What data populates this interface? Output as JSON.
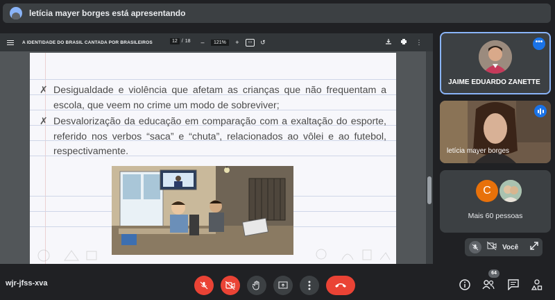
{
  "presenter_bar": {
    "text": "letícia mayer borges está apresentando"
  },
  "pdf_viewer": {
    "title": "A IDENTIDADE DO BRASIL CANTADA POR BRASILEIROS",
    "page_current": "12",
    "page_separator": "/",
    "page_total": "18",
    "zoom_minus": "–",
    "zoom": "121%",
    "zoom_plus": "+"
  },
  "slide": {
    "bullets": [
      {
        "marker": "✗",
        "text": "Desigualdade e violência que afetam as crianças que não frequentam a escola, que veem no crime um modo de sobreviver;"
      },
      {
        "marker": "✗",
        "text": "Desvalorização da educação em comparação com a exaltação do esporte, referido nos verbos “saca” e “chuta”, relacionados ao vôlei e ao futebol, respectivamente."
      }
    ]
  },
  "participants": {
    "main": {
      "name": "JAIME EDUARDO ZANETTE",
      "menu_label": "•••"
    },
    "second": {
      "name": "letícia mayer borges"
    },
    "more": {
      "avatar_letter": "C",
      "label": "Mais 60 pessoas"
    },
    "self": {
      "label": "Você"
    }
  },
  "bottom_bar": {
    "meeting_code": "wjr-jfss-xva",
    "people_count": "64"
  },
  "colors": {
    "background": "#202124",
    "surface": "#3c4043",
    "danger": "#ea4335",
    "accent": "#1a73e8"
  }
}
